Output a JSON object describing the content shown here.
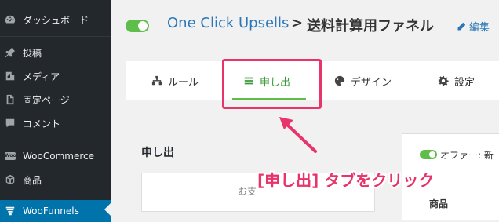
{
  "sidebar": {
    "items": [
      {
        "label": "ダッシュボード",
        "icon": "dashboard-icon"
      },
      {
        "label": "投稿",
        "icon": "pin-icon"
      },
      {
        "label": "メディア",
        "icon": "media-icon"
      },
      {
        "label": "固定ページ",
        "icon": "page-icon"
      },
      {
        "label": "コメント",
        "icon": "comment-icon"
      },
      {
        "label": "WooCommerce",
        "icon": "woo-icon",
        "badge": "Woo"
      },
      {
        "label": "商品",
        "icon": "box-icon"
      },
      {
        "label": "WooFunnels",
        "icon": "funnel-icon",
        "active": true
      }
    ]
  },
  "header": {
    "brand": "One Click Upsells",
    "separator": ">",
    "funnel_title": "送料計算用ファネル",
    "edit_label": "編集"
  },
  "tabs": [
    {
      "label": "ルール",
      "icon": "sitemap-icon"
    },
    {
      "label": "申し出",
      "icon": "list-icon",
      "active": true
    },
    {
      "label": "デザイン",
      "icon": "palette-icon"
    },
    {
      "label": "設定",
      "icon": "gear-icon"
    }
  ],
  "main": {
    "section_title": "申し出",
    "offer_placeholder": "お支"
  },
  "right_panel": {
    "offer_label": "オファー: 新",
    "product_header": "商品"
  },
  "annotation": {
    "callout": "[申し出] タブをクリック"
  },
  "colors": {
    "accent_green": "#5fbe4a",
    "link_blue": "#2a78b8",
    "sidebar_bg": "#23282d",
    "sidebar_active": "#0073aa",
    "highlight_pink": "#e8336b"
  }
}
